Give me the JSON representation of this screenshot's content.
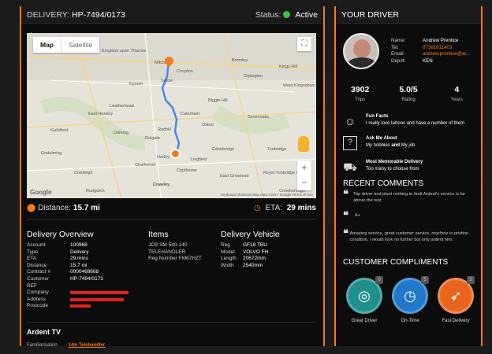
{
  "colors": {
    "accent": "#f07c1d",
    "status_active": "#3fbf3f",
    "redaction": "#e02020"
  },
  "delivery": {
    "header_label": "DELIVERY:",
    "id": "HP-7494/0173",
    "status_label": "Status:",
    "status_value": "Active"
  },
  "map": {
    "tabs": [
      "Map",
      "Satellite"
    ],
    "attribution": "Keyboard shortcuts  Map data ©2017 Google  Terms of Use",
    "logo": "Google",
    "towns": [
      "Kingston upon Thames",
      "Mitcham",
      "Croydon",
      "Bromley",
      "Orpington",
      "West Kingsdown",
      "Sutton",
      "Epsom",
      "Leatherhead",
      "Caterham",
      "Biggin Hill",
      "Sevenoaks",
      "Guildford",
      "East Horsley",
      "Dorking",
      "Redhill",
      "Oxted",
      "Godalming",
      "Reigate",
      "Edenbridge",
      "Tonbridge",
      "Horley",
      "Lingfield",
      "Charlwood",
      "East Grinstead",
      "Crawley",
      "Royal Tunbridge Wells",
      "Cranleigh",
      "Crowborough",
      "Rudgwick",
      "Copthorne",
      "Kings Hill"
    ]
  },
  "distance": {
    "label": "Distance:",
    "value": "15.7 mi"
  },
  "eta": {
    "label": "ETA:",
    "value": "29 mins"
  },
  "overview": {
    "title": "Delivery Overview",
    "rows": [
      {
        "k": "Account",
        "v": "100968"
      },
      {
        "k": "Type",
        "v": "Delivery"
      },
      {
        "k": "ETA",
        "v": "29 mins"
      },
      {
        "k": "Distance",
        "v": "15.7 mi"
      },
      {
        "k": "Contract #",
        "v": "0000468668"
      },
      {
        "k": "Customer",
        "v": "HP-7494/0173"
      },
      {
        "k": "REF",
        "v": ""
      }
    ],
    "redacted_rows": [
      "Company",
      "Address",
      "Postcode"
    ]
  },
  "items": {
    "title": "Items",
    "lines": [
      "JCB SM 540-140",
      "TELEHANDLER",
      "Reg Number FM67HZT"
    ]
  },
  "vehicle": {
    "title": "Delivery Vehicle",
    "rows": [
      {
        "k": "Reg",
        "v": "GF18 TBU"
      },
      {
        "k": "Model",
        "v": "VOLVO FH"
      },
      {
        "k": "Length",
        "v": "20672mm"
      },
      {
        "k": "Width",
        "v": "2540mm"
      }
    ]
  },
  "ardent": {
    "title": "Ardent TV",
    "label": "Familiarisation",
    "link": "14m Telehandler"
  },
  "driver": {
    "title": "YOUR DRIVER",
    "info": [
      {
        "k": "Name:",
        "v": "Andrew Prentice"
      },
      {
        "k": "Tel:",
        "v": "07391011403"
      },
      {
        "k": "Email:",
        "v": "andrew.prentice@ar..."
      },
      {
        "k": "Depot:",
        "v": "KEN"
      }
    ],
    "stats": [
      {
        "n": "3902",
        "l": "Trips"
      },
      {
        "n": "5.0/5",
        "l": "Rating"
      },
      {
        "n": "4",
        "l": "Years"
      }
    ],
    "facts": [
      {
        "icon": "smiley-icon",
        "t": "Fun Facts",
        "d": "I really love tattoos and have a number of them"
      },
      {
        "icon": "question-icon",
        "t": "Ask Me About",
        "d1": "My hobbies ",
        "d2": "and",
        "d3": " My job"
      },
      {
        "icon": "truck-icon",
        "t": "Most Memorable Delivery",
        "d": "Too many to choose from"
      }
    ]
  },
  "comments": {
    "title": "RECENT COMMENTS",
    "items": [
      "Top driver and plant nothing to fault Ardent's service is far above the rest",
      "A+",
      "Amazing service, great customer service, machine in pristine condition, i would look no further but only ardent hire."
    ]
  },
  "compliments": {
    "title": "CUSTOMER COMPLIMENTS",
    "badges": [
      {
        "label": "Great Driver",
        "count": "0",
        "color": "#1f8f8f"
      },
      {
        "label": "On-Time",
        "count": "5",
        "color": "#1f78c8"
      },
      {
        "label": "Fast Delivery",
        "count": "5",
        "color": "#e8641c"
      }
    ]
  }
}
